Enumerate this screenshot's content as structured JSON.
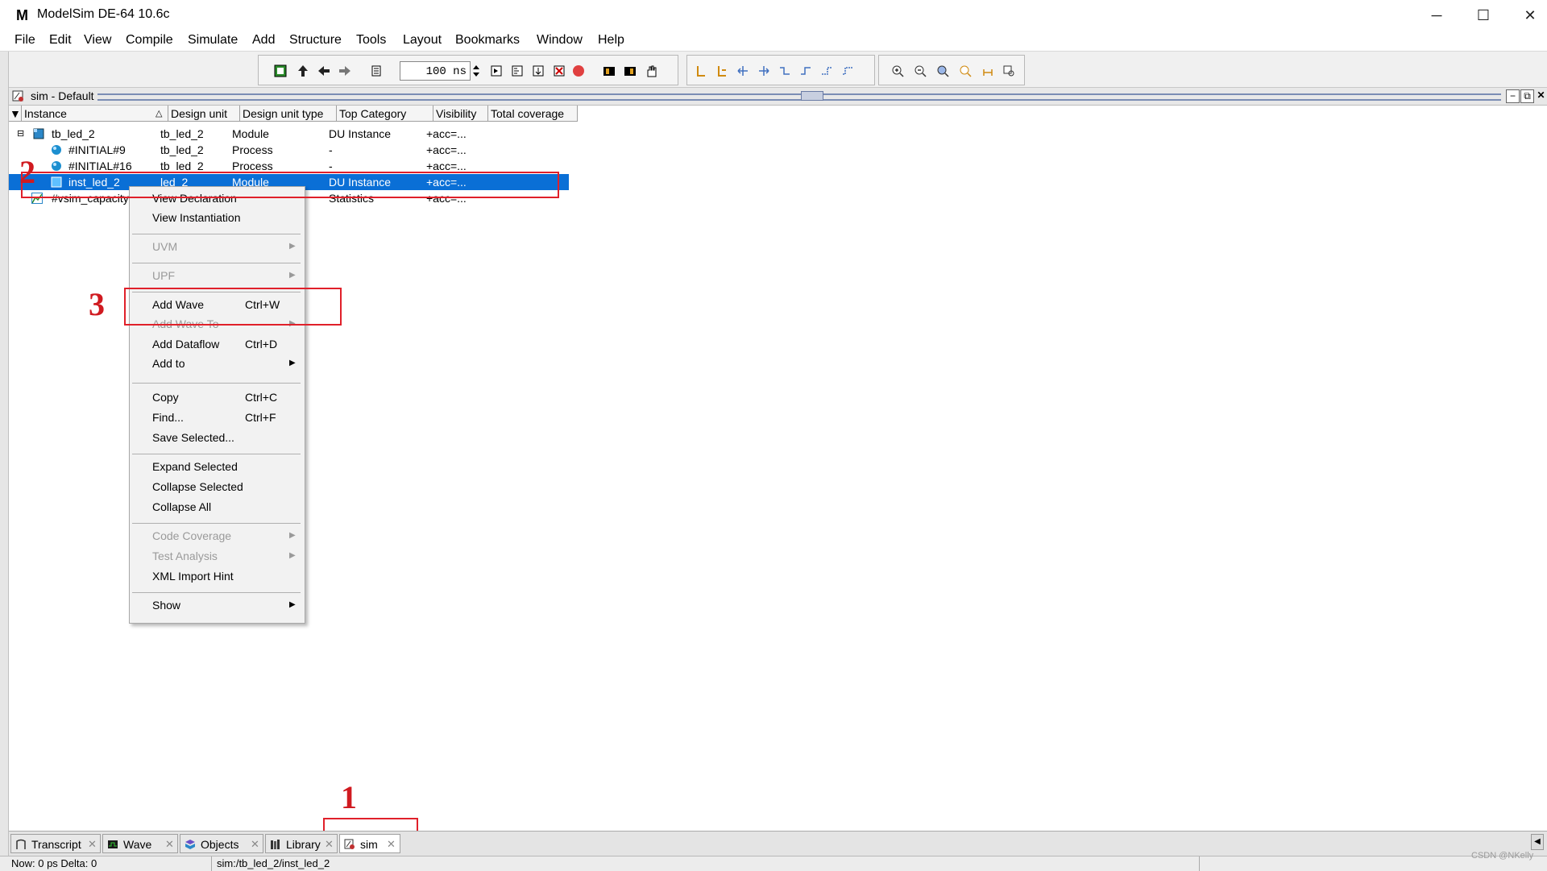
{
  "window": {
    "title": "ModelSim DE-64 10.6c",
    "logo": "M",
    "minimize": "─",
    "maximize": "☐",
    "close": "✕"
  },
  "menubar": [
    "File",
    "Edit",
    "View",
    "Compile",
    "Simulate",
    "Add",
    "Structure",
    "Tools",
    "Layout",
    "Bookmarks",
    "Window",
    "Help"
  ],
  "toolbar": {
    "run_length": "100 ns"
  },
  "pane": {
    "title": "sim - Default"
  },
  "columns": [
    "Instance",
    "Design unit",
    "Design unit type",
    "Top Category",
    "Visibility",
    "Total coverage"
  ],
  "rows": [
    {
      "instance": "tb_led_2",
      "unit": "tb_led_2",
      "type": "Module",
      "category": "DU Instance",
      "visibility": "+acc=..."
    },
    {
      "instance": "#INITIAL#9",
      "unit": "tb_led_2",
      "type": "Process",
      "category": "-",
      "visibility": "+acc=..."
    },
    {
      "instance": "#INITIAL#16",
      "unit": "tb_led_2",
      "type": "Process",
      "category": "-",
      "visibility": "+acc=..."
    },
    {
      "instance": "inst_led_2",
      "unit": "led_2",
      "type": "Module",
      "category": "DU Instance",
      "visibility": "+acc=..."
    },
    {
      "instance": "#vsim_capacity",
      "unit": "",
      "type": "",
      "category": "Statistics",
      "visibility": "+acc=..."
    }
  ],
  "context_menu": {
    "view_declaration": "View Declaration",
    "view_instantiation": "View Instantiation",
    "uvm": "UVM",
    "upf": "UPF",
    "add_wave": "Add Wave",
    "add_wave_sc": "Ctrl+W",
    "add_wave_to": "Add Wave To",
    "add_dataflow": "Add Dataflow",
    "add_dataflow_sc": "Ctrl+D",
    "add_to": "Add to",
    "copy": "Copy",
    "copy_sc": "Ctrl+C",
    "find": "Find...",
    "find_sc": "Ctrl+F",
    "save_selected": "Save Selected...",
    "expand_selected": "Expand Selected",
    "collapse_selected": "Collapse Selected",
    "collapse_all": "Collapse All",
    "code_coverage": "Code Coverage",
    "test_analysis": "Test Analysis",
    "xml_import_hint": "XML Import Hint",
    "show": "Show"
  },
  "annotations": [
    "1",
    "2",
    "3"
  ],
  "tabs": [
    "Transcript",
    "Wave",
    "Objects",
    "Library",
    "sim"
  ],
  "status": {
    "now": "Now: 0 ps   Delta: 0",
    "path": "sim:/tb_led_2/inst_led_2"
  },
  "watermark": "CSDN @NKelly",
  "colors": {
    "selection": "#0a6fd6",
    "annotation": "#e0202a"
  }
}
